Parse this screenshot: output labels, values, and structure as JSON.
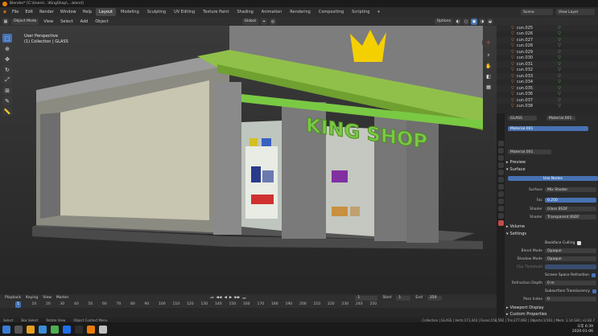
{
  "titlebar": {
    "title": "Blender* [C:\\Users\\...\\KingShop\\....blend]"
  },
  "menu": [
    "File",
    "Edit",
    "Render",
    "Window",
    "Help"
  ],
  "workspaces": [
    "Layout",
    "Modeling",
    "Sculpting",
    "UV Editing",
    "Texture Paint",
    "Shading",
    "Animation",
    "Rendering",
    "Compositing",
    "Scripting"
  ],
  "active_workspace": "Layout",
  "scene": {
    "scene_label": "Scene",
    "view_layer": "View Layer"
  },
  "viewport_header": {
    "mode": "Object Mode",
    "view": "View",
    "select": "Select",
    "add": "Add",
    "object": "Object",
    "orientation": "Global",
    "options": "Options"
  },
  "viewport_info": {
    "line1": "User Perspective",
    "line2": "(1) Collection | GLASS"
  },
  "scene_text": {
    "sign": "KING SHOP"
  },
  "outliner": {
    "items": [
      "cun.025",
      "cun.026",
      "cun.027",
      "cun.028",
      "cun.029",
      "cun.030",
      "cun.031",
      "cun.032",
      "cun.033",
      "cun.034",
      "cun.035",
      "cun.036",
      "cun.037",
      "cun.038"
    ]
  },
  "properties": {
    "object": "GLASS",
    "material_slot": "Material.001",
    "material_list_item": "Material.001",
    "material_name": "Material.001",
    "preview": "Preview",
    "surface_section": "Surface",
    "use_nodes": "Use Nodes",
    "surface_label": "Surface",
    "surface_value": "Mix Shader",
    "fac_label": "Fac",
    "fac_value": "0.250",
    "shader1_label": "Shader",
    "shader1_value": "Glass BSDF",
    "shader2_label": "Shader",
    "shader2_value": "Transparent BSDF",
    "volume": "Volume",
    "settings": "Settings",
    "backface": "Backface Culling",
    "blend_label": "Blend Mode",
    "blend_value": "Opaque",
    "shadow_label": "Shadow Mode",
    "shadow_value": "Opaque",
    "clip_label": "Clip Threshold",
    "ssr": "Screen Space Refraction",
    "refr_label": "Refraction Depth",
    "refr_value": "0 m",
    "sss": "Subsurface Translucency",
    "pass_label": "Pass Index",
    "pass_value": "0",
    "viewport_display": "Viewport Display",
    "custom_props": "Custom Properties"
  },
  "timeline": {
    "playback": "Playback",
    "keying": "Keying",
    "view": "View",
    "marker": "Marker",
    "current_frame": "1",
    "start_label": "Start",
    "start": "1",
    "end_label": "End",
    "end": "250",
    "ticks": [
      "1",
      "10",
      "20",
      "30",
      "40",
      "50",
      "60",
      "70",
      "80",
      "90",
      "100",
      "110",
      "120",
      "130",
      "140",
      "150",
      "160",
      "170",
      "180",
      "190",
      "200",
      "210",
      "220",
      "230",
      "240",
      "250"
    ]
  },
  "statusbar": {
    "select": "Select",
    "box_select": "Box Select",
    "rotate_view": "Rotate View",
    "context_menu": "Object Context Menu",
    "stats": "Collection | GLASS | Verts:171,443 | Faces:158,592 | Tris:277,992 | Objects:1/161 | Mem: 1.14 GiB | v2.82.7"
  },
  "clock": {
    "time": "오후 6:39",
    "date": "2020-01-06"
  },
  "colors": {
    "accent": "#4772b3",
    "ui_bg": "#2b2b2b",
    "sign_green": "#7ac943",
    "crown": "#f5d000"
  }
}
